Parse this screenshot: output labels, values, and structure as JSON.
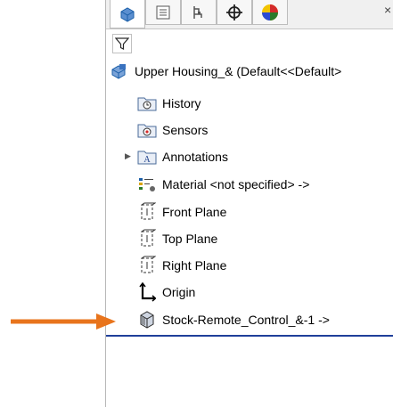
{
  "window": {
    "close_glyph": "×"
  },
  "tabs": [
    {
      "name": "feature-manager-tab",
      "icon": "part-icon"
    },
    {
      "name": "property-manager-tab",
      "icon": "list-icon"
    },
    {
      "name": "configuration-manager-tab",
      "icon": "config-icon"
    },
    {
      "name": "dimxpert-tab",
      "icon": "crosshair-icon"
    },
    {
      "name": "display-manager-tab",
      "icon": "color-pie-icon"
    }
  ],
  "filter": {
    "icon": "filter-icon"
  },
  "tree": {
    "root_label": "Upper Housing_&  (Default<<Default>",
    "items": [
      {
        "label": "History",
        "icon": "history-folder-icon"
      },
      {
        "label": "Sensors",
        "icon": "sensors-folder-icon"
      },
      {
        "label": "Annotations",
        "icon": "annotations-folder-icon"
      },
      {
        "label": "Material <not specified> ->",
        "icon": "material-icon"
      },
      {
        "label": "Front Plane",
        "icon": "plane-icon"
      },
      {
        "label": "Top Plane",
        "icon": "plane-icon"
      },
      {
        "label": "Right Plane",
        "icon": "plane-icon"
      },
      {
        "label": "Origin",
        "icon": "origin-icon"
      },
      {
        "label": "Stock-Remote_Control_&-1 ->",
        "icon": "derived-part-icon"
      }
    ]
  },
  "colors": {
    "arrow": "#e8741c",
    "rollback_bar": "#1f3f9a",
    "icon_blue": "#1b5fa8"
  }
}
